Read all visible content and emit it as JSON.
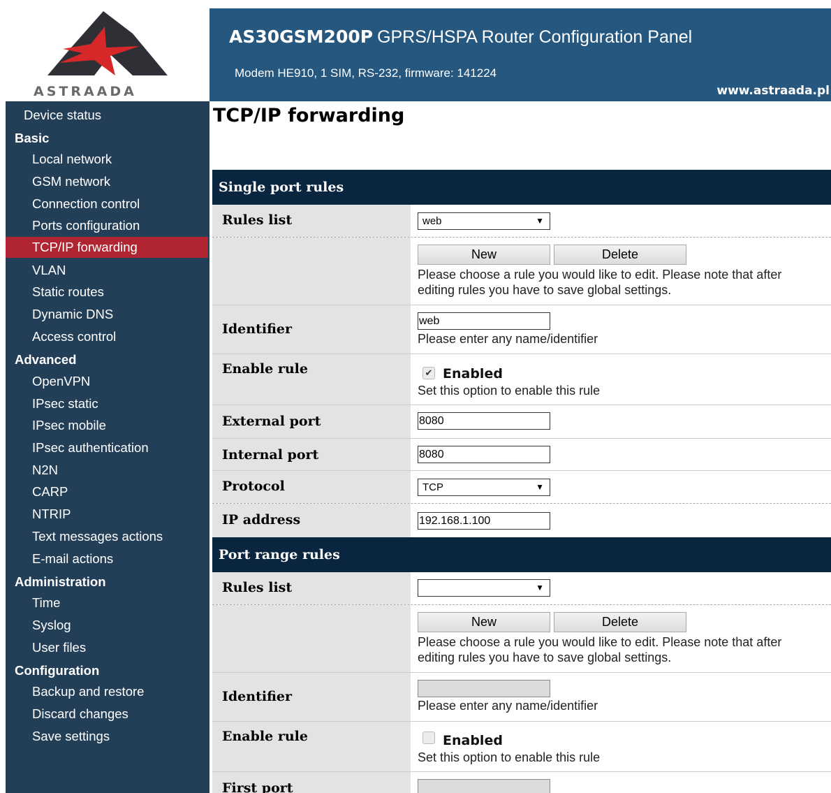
{
  "brand": {
    "logo_text": "ASTRAADA",
    "model": "AS30GSM200P",
    "description": "GPRS/HSPA Router Configuration Panel",
    "subtitle": "Modem HE910, 1 SIM, RS-232, firmware: 141224",
    "url": "www.astraada.pl"
  },
  "sidebar": {
    "device_status": "Device status",
    "basic": "Basic",
    "local_network": "Local network",
    "gsm_network": "GSM network",
    "connection_control": "Connection control",
    "ports_configuration": "Ports configuration",
    "tcpip_forwarding": "TCP/IP forwarding",
    "vlan": "VLAN",
    "static_routes": "Static routes",
    "dynamic_dns": "Dynamic DNS",
    "access_control": "Access control",
    "advanced": "Advanced",
    "openvpn": "OpenVPN",
    "ipsec_static": "IPsec static",
    "ipsec_mobile": "IPsec mobile",
    "ipsec_authentication": "IPsec authentication",
    "n2n": "N2N",
    "carp": "CARP",
    "ntrip": "NTRIP",
    "text_messages_actions": "Text messages actions",
    "email_actions": "E-mail actions",
    "administration": "Administration",
    "time": "Time",
    "syslog": "Syslog",
    "user_files": "User files",
    "configuration": "Configuration",
    "backup_and_restore": "Backup and restore",
    "discard_changes": "Discard changes",
    "save_settings": "Save settings"
  },
  "page": {
    "title": "TCP/IP forwarding"
  },
  "single_port": {
    "header": "Single port rules",
    "rules_list_label": "Rules list",
    "rules_list_value": "web",
    "new_button": "New",
    "delete_button": "Delete",
    "choose_hint_line1": "Please choose a rule you would like to edit. Please note that after",
    "choose_hint_line2": "editing rules you have to save global settings.",
    "identifier_label": "Identifier",
    "identifier_value": "web",
    "identifier_hint": "Please enter any name/identifier",
    "enable_label": "Enable rule",
    "enabled_text": "Enabled",
    "enabled_checked": true,
    "enable_hint": "Set this option to enable this rule",
    "external_port_label": "External port",
    "external_port_value": "8080",
    "internal_port_label": "Internal port",
    "internal_port_value": "8080",
    "protocol_label": "Protocol",
    "protocol_value": "TCP",
    "ip_label": "IP address",
    "ip_value": "192.168.1.100"
  },
  "port_range": {
    "header": "Port range rules",
    "rules_list_label": "Rules list",
    "rules_list_value": "",
    "new_button": "New",
    "delete_button": "Delete",
    "choose_hint_line1": "Please choose a rule you would like to edit. Please note that after",
    "choose_hint_line2": "editing rules you have to save global settings.",
    "identifier_label": "Identifier",
    "identifier_value": "",
    "identifier_hint": "Please enter any name/identifier",
    "enable_label": "Enable rule",
    "enabled_text": "Enabled",
    "enabled_checked": false,
    "enable_hint": "Set this option to enable this rule",
    "first_port_label": "First port"
  },
  "icons": {
    "dropdown": "▼",
    "check": "✔"
  },
  "colors": {
    "header_bg": "#25577f",
    "sidebar_bg": "#233f58",
    "active_item": "#b12532",
    "section_bg": "#0a2540"
  }
}
